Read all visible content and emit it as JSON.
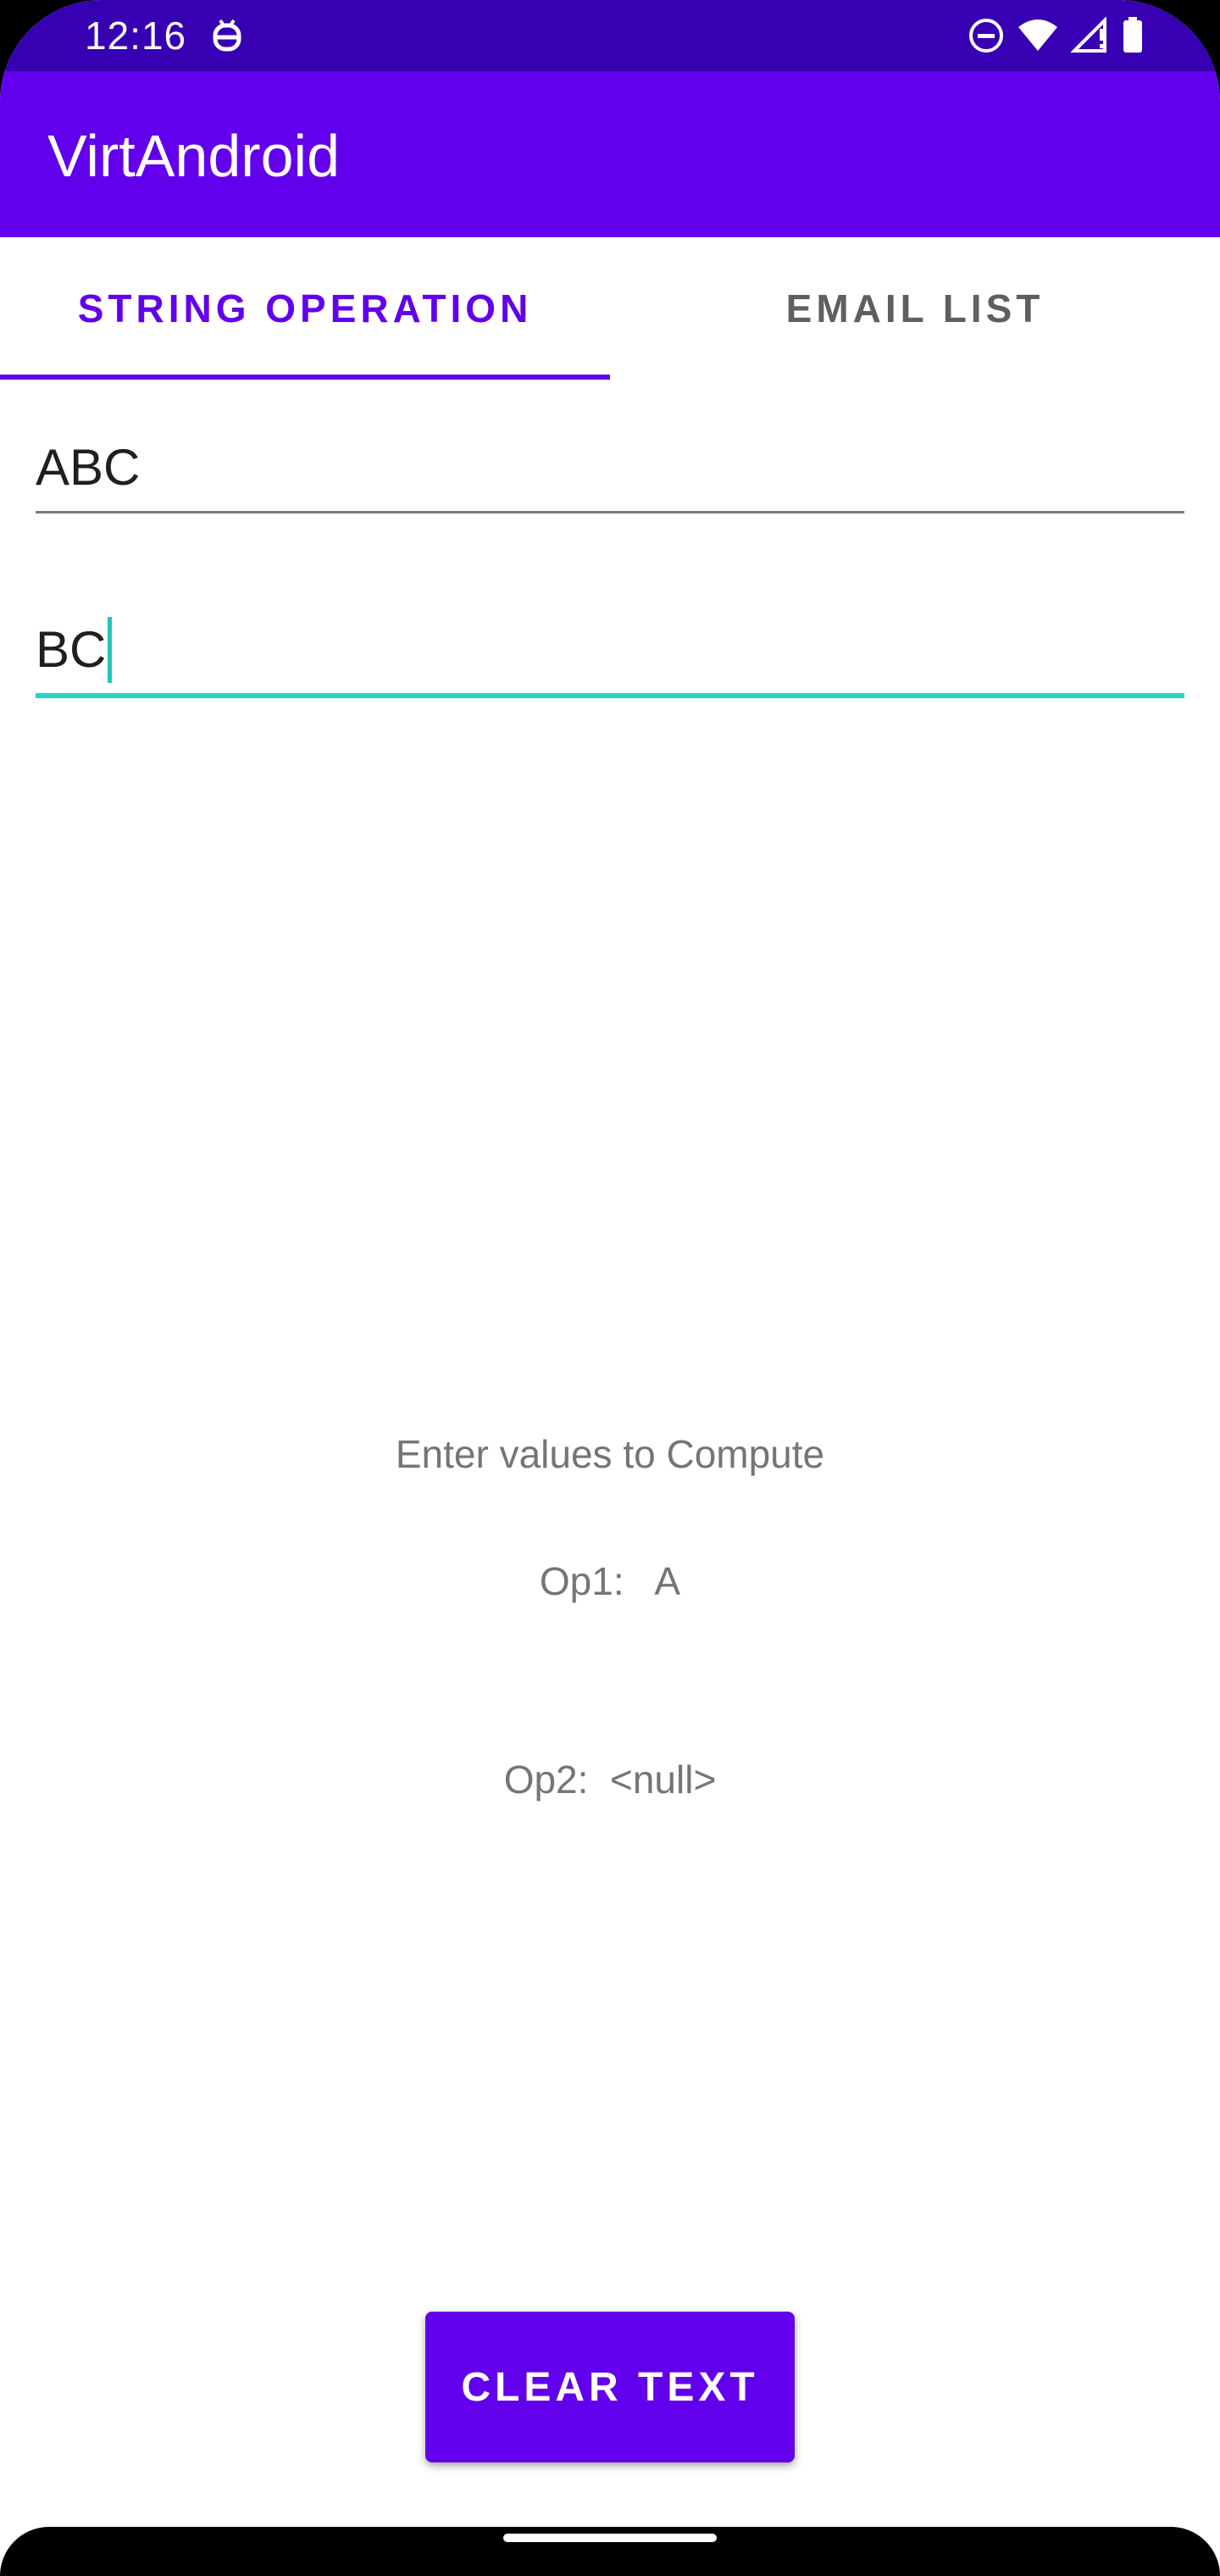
{
  "status_bar": {
    "time": "12:16",
    "left_icon": "assistant-icon",
    "right_icons": [
      "do-not-disturb-icon",
      "wifi-icon",
      "signal-icon",
      "battery-icon"
    ],
    "background_color": "#3700b3"
  },
  "app_bar": {
    "title": "VirtAndroid",
    "background_color": "#6200ee"
  },
  "tabs": [
    {
      "label": "STRING OPERATION",
      "selected": true
    },
    {
      "label": "EMAIL LIST",
      "selected": false
    }
  ],
  "inputs": {
    "first": {
      "value": "ABC"
    },
    "second": {
      "value": "BC",
      "focused": true,
      "accent_color": "#26d4c4"
    }
  },
  "results": {
    "prompt": "Enter values to Compute",
    "op1": "Op1:   A",
    "op2": "Op2:  <null>"
  },
  "clear_button": {
    "label": "CLEAR TEXT"
  }
}
